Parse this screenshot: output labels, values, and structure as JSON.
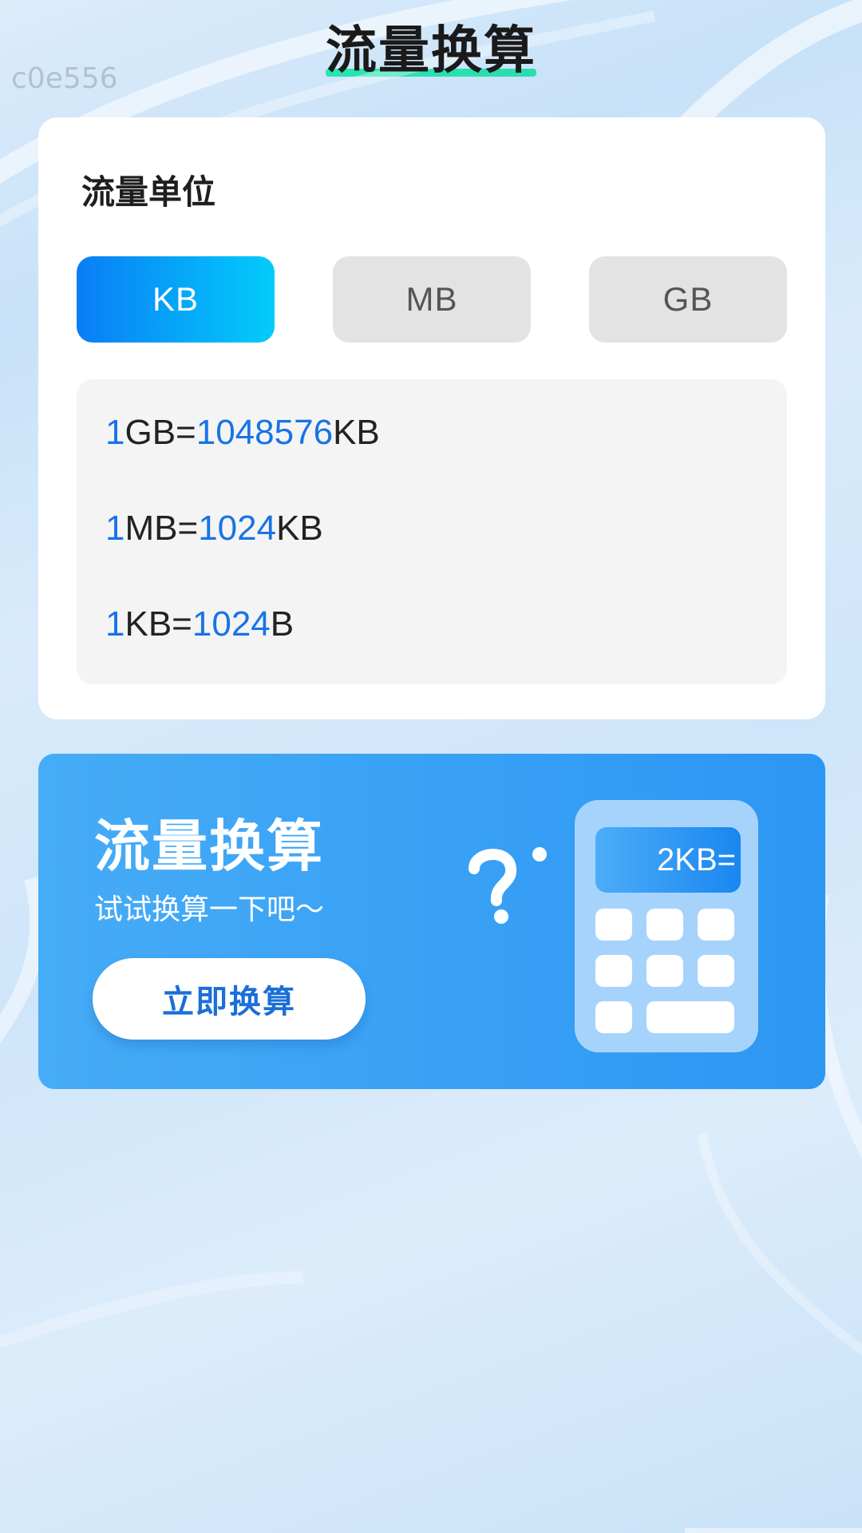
{
  "watermark": "c0e556",
  "header": {
    "title": "流量换算"
  },
  "units_card": {
    "label": "流量单位",
    "buttons": [
      {
        "label": "KB",
        "selected": true
      },
      {
        "label": "MB",
        "selected": false
      },
      {
        "label": "GB",
        "selected": false
      }
    ],
    "conversions": [
      {
        "lhs_num": "1",
        "lhs_unit": "GB=",
        "rhs_num": "1048576",
        "rhs_unit": "KB"
      },
      {
        "lhs_num": "1",
        "lhs_unit": "MB=",
        "rhs_num": "1024",
        "rhs_unit": "KB"
      },
      {
        "lhs_num": "1",
        "lhs_unit": "KB=",
        "rhs_num": "1024",
        "rhs_unit": "B"
      }
    ]
  },
  "promo": {
    "title": "流量换算",
    "subtitle": "试试换算一下吧～",
    "button_label": "立即换算",
    "calculator_display": "2KB="
  },
  "colors": {
    "accent_blue": "#1774e6",
    "active_gradient_start": "#0a7df5",
    "active_gradient_end": "#03ccfb",
    "promo_bg": "#3aa2f5",
    "title_underline": "#27e6b0"
  },
  "icons": {
    "question_mark": "question-mark-icon",
    "calculator": "calculator-icon"
  }
}
